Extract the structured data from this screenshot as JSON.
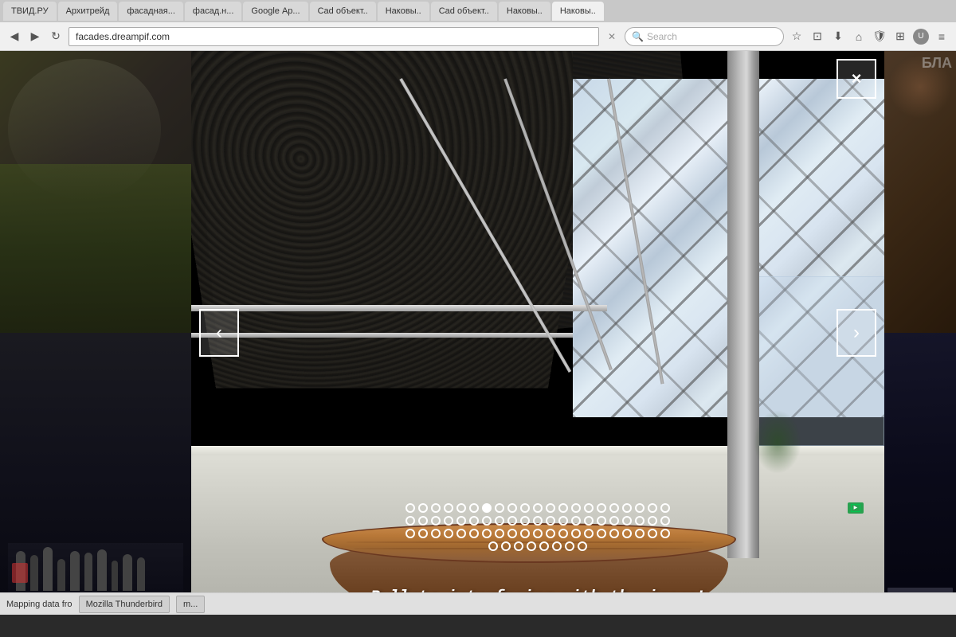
{
  "browser": {
    "address": "facades.dreampif.com",
    "search_placeholder": "Search",
    "tabs": [
      {
        "label": "ТВИД.РУ",
        "active": false
      },
      {
        "label": "Архитрейд",
        "active": false
      },
      {
        "label": "фасадная...",
        "active": false
      },
      {
        "label": "фасад.н...",
        "active": false
      },
      {
        "label": "Google Ар...",
        "active": false
      },
      {
        "label": "Cad объект..",
        "active": false
      },
      {
        "label": "Наковы..",
        "active": false
      },
      {
        "label": "Cad объект..",
        "active": false
      },
      {
        "label": "Наковы..",
        "active": false
      },
      {
        "label": "Наковы..",
        "active": true
      }
    ],
    "status": {
      "map_text": "Mapping data fro",
      "items": [
        "Mozilla Thunderbird",
        "m..."
      ]
    }
  },
  "lightbox": {
    "close_label": "×",
    "prev_label": "‹",
    "next_label": "›",
    "warning_text": "Bullets interfering with the image!",
    "cyrillic": "БЛА"
  },
  "bullets": {
    "rows": [
      {
        "count": 21,
        "active_index": 6
      },
      {
        "count": 21,
        "active_index": -1
      },
      {
        "count": 21,
        "active_index": -1
      },
      {
        "count": 8,
        "active_index": -1
      }
    ]
  },
  "icons": {
    "search": "🔍",
    "star": "☆",
    "bookmark": "⛉",
    "download": "⬇",
    "home": "⌂",
    "shield": "🛡",
    "puzzle": "⊞",
    "menu": "≡"
  }
}
